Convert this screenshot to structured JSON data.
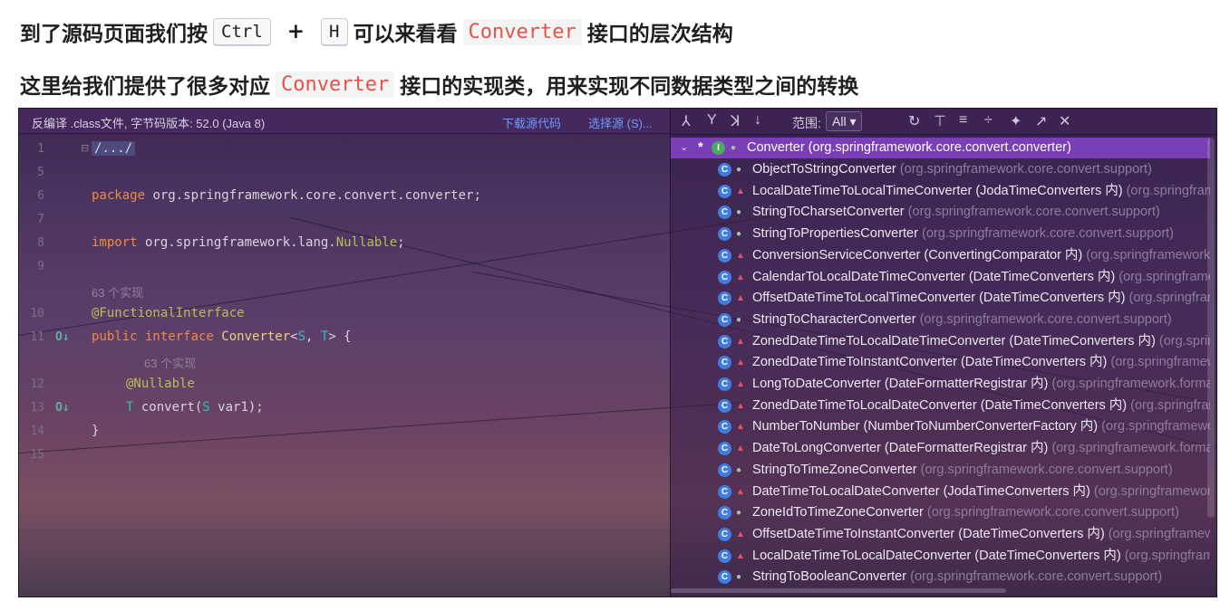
{
  "article": {
    "line1": {
      "text_a": "到了源码页面我们按",
      "key_ctrl": "Ctrl",
      "plus": "+",
      "key_h": "H",
      "text_b": "可以来看看",
      "code": "Converter",
      "text_c": "接口的层次结构"
    },
    "line2": {
      "text_a": "这里给我们提供了很多对应",
      "code": "Converter",
      "text_b": "接口的实现类，用来实现不同数据类型之间的转换"
    }
  },
  "editor": {
    "header_info": "反编译 .class文件, 字节码版本: 52.0 (Java 8)",
    "download_source": "下载源代码",
    "choose_source": "选择源 (S)...",
    "line_numbers": [
      "1",
      "5",
      "6",
      "7",
      "8",
      "9",
      "10",
      "11",
      "12",
      "13",
      "14",
      "15"
    ],
    "code": {
      "fold": "/.../",
      "package_kw": "package",
      "package_name": " org.springframework.core.convert.converter;",
      "import_kw": "import",
      "import_name": " org.springframework.lang.",
      "import_class": "Nullable",
      "import_end": ";",
      "impl_hint": "63 个实现",
      "annotation": "@FunctionalInterface",
      "public_kw": "public",
      "interface_kw": " interface ",
      "iface_name": "Converter",
      "generics_open": "<",
      "type_s": "S",
      "comma": ", ",
      "type_t": "T",
      "generics_close": "> {",
      "method_hint": "63 个实现",
      "nullable": "@Nullable",
      "ret_t": "T",
      "method_sig": " convert(",
      "param_s": "S",
      "param_rest": " var1);",
      "close_brace": "}"
    }
  },
  "hierarchy": {
    "scope_label": "范围:",
    "scope_value": "All",
    "root": {
      "name": "Converter (org.springframework.core.convert.converter)"
    },
    "items": [
      {
        "name": "ObjectToStringConverter",
        "pkg": "(org.springframework.core.convert.support)",
        "vis": "public"
      },
      {
        "name": "LocalDateTimeToLocalTimeConverter (JodaTimeConverters 内)",
        "pkg": "(org.springframework.format.datetime.joda)",
        "vis": "private"
      },
      {
        "name": "StringToCharsetConverter",
        "pkg": "(org.springframework.core.convert.support)",
        "vis": "public"
      },
      {
        "name": "StringToPropertiesConverter",
        "pkg": "(org.springframework.core.convert.support)",
        "vis": "public"
      },
      {
        "name": "ConversionServiceConverter (ConvertingComparator 内)",
        "pkg": "(org.springframework.core.convert.converter)",
        "vis": "private"
      },
      {
        "name": "CalendarToLocalDateTimeConverter (DateTimeConverters 内)",
        "pkg": "(org.springframework.format.datetime.standard)",
        "vis": "private"
      },
      {
        "name": "OffsetDateTimeToLocalTimeConverter (DateTimeConverters 内)",
        "pkg": "(org.springframework.format.datetime.standard)",
        "vis": "private"
      },
      {
        "name": "StringToCharacterConverter",
        "pkg": "(org.springframework.core.convert.support)",
        "vis": "public"
      },
      {
        "name": "ZonedDateTimeToLocalDateTimeConverter (DateTimeConverters 内)",
        "pkg": "(org.springframework.format.datetime.standard)",
        "vis": "private"
      },
      {
        "name": "ZonedDateTimeToInstantConverter (DateTimeConverters 内)",
        "pkg": "(org.springframework.format.datetime.standard)",
        "vis": "private"
      },
      {
        "name": "LongToDateConverter (DateFormatterRegistrar 内)",
        "pkg": "(org.springframework.format.datetime)",
        "vis": "private"
      },
      {
        "name": "ZonedDateTimeToLocalDateConverter (DateTimeConverters 内)",
        "pkg": "(org.springframework.format.datetime.standard)",
        "vis": "private"
      },
      {
        "name": "NumberToNumber (NumberToNumberConverterFactory 内)",
        "pkg": "(org.springframework.core.convert.support)",
        "vis": "private"
      },
      {
        "name": "DateToLongConverter (DateFormatterRegistrar 内)",
        "pkg": "(org.springframework.format.datetime)",
        "vis": "private"
      },
      {
        "name": "StringToTimeZoneConverter",
        "pkg": "(org.springframework.core.convert.support)",
        "vis": "public"
      },
      {
        "name": "DateTimeToLocalDateConverter (JodaTimeConverters 内)",
        "pkg": "(org.springframework.format.datetime.joda)",
        "vis": "private"
      },
      {
        "name": "ZoneIdToTimeZoneConverter",
        "pkg": "(org.springframework.core.convert.support)",
        "vis": "public"
      },
      {
        "name": "OffsetDateTimeToInstantConverter (DateTimeConverters 内)",
        "pkg": "(org.springframework.format.datetime.standard)",
        "vis": "private"
      },
      {
        "name": "LocalDateTimeToLocalDateConverter (DateTimeConverters 内)",
        "pkg": "(org.springframework.format.datetime.standard)",
        "vis": "private"
      },
      {
        "name": "StringToBooleanConverter",
        "pkg": "(org.springframework.core.convert.support)",
        "vis": "public"
      }
    ]
  }
}
